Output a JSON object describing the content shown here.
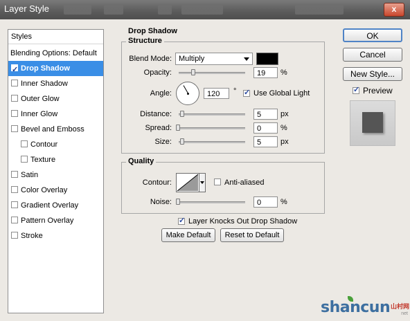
{
  "window": {
    "title": "Layer Style",
    "close_glyph": "x"
  },
  "styles_panel": {
    "header": "Styles",
    "items": [
      {
        "label": "Blending Options: Default",
        "has_checkbox": false,
        "checked": false,
        "selected": false,
        "indent": false
      },
      {
        "label": "Drop Shadow",
        "has_checkbox": true,
        "checked": true,
        "selected": true,
        "indent": false
      },
      {
        "label": "Inner Shadow",
        "has_checkbox": true,
        "checked": false,
        "selected": false,
        "indent": false
      },
      {
        "label": "Outer Glow",
        "has_checkbox": true,
        "checked": false,
        "selected": false,
        "indent": false
      },
      {
        "label": "Inner Glow",
        "has_checkbox": true,
        "checked": false,
        "selected": false,
        "indent": false
      },
      {
        "label": "Bevel and Emboss",
        "has_checkbox": true,
        "checked": false,
        "selected": false,
        "indent": false
      },
      {
        "label": "Contour",
        "has_checkbox": true,
        "checked": false,
        "selected": false,
        "indent": true
      },
      {
        "label": "Texture",
        "has_checkbox": true,
        "checked": false,
        "selected": false,
        "indent": true
      },
      {
        "label": "Satin",
        "has_checkbox": true,
        "checked": false,
        "selected": false,
        "indent": false
      },
      {
        "label": "Color Overlay",
        "has_checkbox": true,
        "checked": false,
        "selected": false,
        "indent": false
      },
      {
        "label": "Gradient Overlay",
        "has_checkbox": true,
        "checked": false,
        "selected": false,
        "indent": false
      },
      {
        "label": "Pattern Overlay",
        "has_checkbox": true,
        "checked": false,
        "selected": false,
        "indent": false
      },
      {
        "label": "Stroke",
        "has_checkbox": true,
        "checked": false,
        "selected": false,
        "indent": false
      }
    ]
  },
  "drop_shadow": {
    "section_title": "Drop Shadow",
    "structure": {
      "title": "Structure",
      "blend_mode_label": "Blend Mode:",
      "blend_mode_value": "Multiply",
      "shadow_color": "#000000",
      "opacity_label": "Opacity:",
      "opacity_value": "19",
      "opacity_unit": "%",
      "opacity_level": 0.19,
      "angle_label": "Angle:",
      "angle_value": "120",
      "angle_unit": "°",
      "angle_degrees": 120,
      "use_global_light_label": "Use Global Light",
      "use_global_light_checked": true,
      "distance_label": "Distance:",
      "distance_value": "5",
      "distance_unit": "px",
      "distance_level": 0.02,
      "spread_label": "Spread:",
      "spread_value": "0",
      "spread_unit": "%",
      "spread_level": 0,
      "size_label": "Size:",
      "size_value": "5",
      "size_unit": "px",
      "size_level": 0.02
    },
    "quality": {
      "title": "Quality",
      "contour_label": "Contour:",
      "anti_aliased_label": "Anti-aliased",
      "anti_aliased_checked": false,
      "noise_label": "Noise:",
      "noise_value": "0",
      "noise_unit": "%",
      "noise_level": 0
    },
    "knocks_out_label": "Layer Knocks Out Drop Shadow",
    "knocks_out_checked": true,
    "make_default_label": "Make Default",
    "reset_default_label": "Reset to Default"
  },
  "right_panel": {
    "ok_label": "OK",
    "cancel_label": "Cancel",
    "new_style_label": "New Style...",
    "preview_label": "Preview",
    "preview_checked": true
  },
  "watermark": {
    "brand": "shancun",
    "cn": "山村网",
    "domain": "net"
  }
}
